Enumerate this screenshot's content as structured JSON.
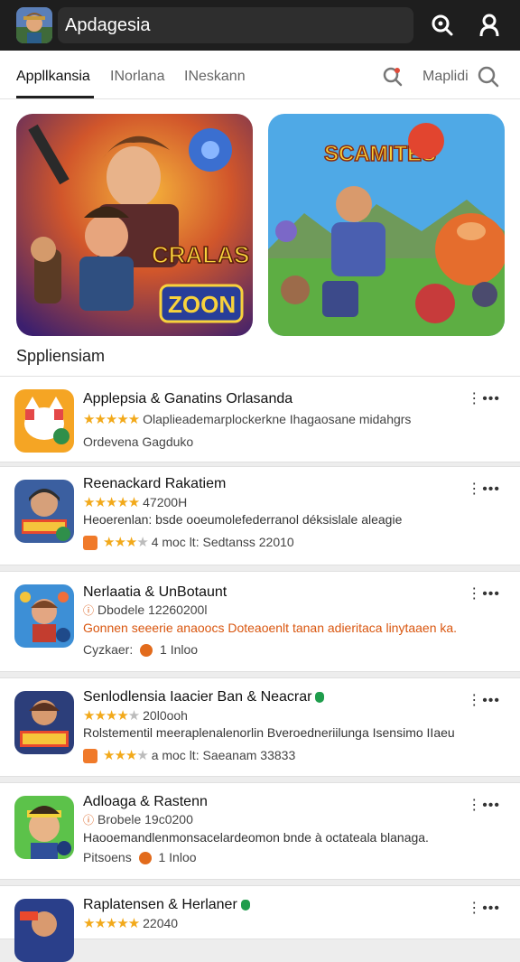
{
  "header": {
    "title": "Apdagesia",
    "app_icon": "app-logo",
    "search_icon": "search-icon",
    "profile_icon": "user-icon"
  },
  "tabs": {
    "items": [
      {
        "label": "Appllkansia"
      },
      {
        "label": "INorlana"
      },
      {
        "label": "INeskann"
      }
    ],
    "right_label": "Maplidi",
    "pin_icon": "location-pin-icon",
    "search_icon": "search-icon"
  },
  "featured": {
    "banner1_text": "CRALAS",
    "banner1_text2": "ZOON",
    "banner2_text": "SCAMITES",
    "section_title": "Sppliensiam"
  },
  "apps": [
    {
      "title": "Applepsia & Ganatins Orlasanda",
      "line1": "Olaplieademarplockerkne Ihagaosane midahgrs",
      "line2": "Ordevena Gagduko",
      "stars": "★★★★★"
    },
    {
      "title": "Reenackard Rakatiem",
      "rating_text": "47200H",
      "line1": "Heoerenlan: bsde ooeumolefederranol déksislale aleagie",
      "line2": "4 moc lt: Sedtanss 22010",
      "stars": "★★★★★"
    },
    {
      "title": "Nerlaatia & UnBotaunt",
      "line0": "Dbodele 12260200l",
      "line1": "Gonnen seeerie anaoocs Doteaoenlt tanan adieritaca linytaaen ka.",
      "line2_a": "Cyzkaer:",
      "line2_b": "1 Inloo"
    },
    {
      "title": "Senlodlensia Iaacier Ban & Neacrar",
      "rating_text": "20l0ooh",
      "line1": "Rolstementil meeraplenalenorlin Bveroedneriilunga Isensimo IIaeu",
      "line2": "a moc lt: Saeanam 33833"
    },
    {
      "title": "Adloaga & Rastenn",
      "line0": "Brobele 19c0200",
      "line1": "Haooemandlenmonsacelardeomon bnde à octateala blanaga.",
      "line2_a": "Pitsoens",
      "line2_b": "1 Inloo"
    },
    {
      "title": "Raplatensen & Herlaner",
      "rating_text": "22040"
    }
  ],
  "menu_label": "⋮•••",
  "colors": {
    "star": "#f2a91a",
    "accent": "#d9560f",
    "verified": "#1f9d4c"
  }
}
